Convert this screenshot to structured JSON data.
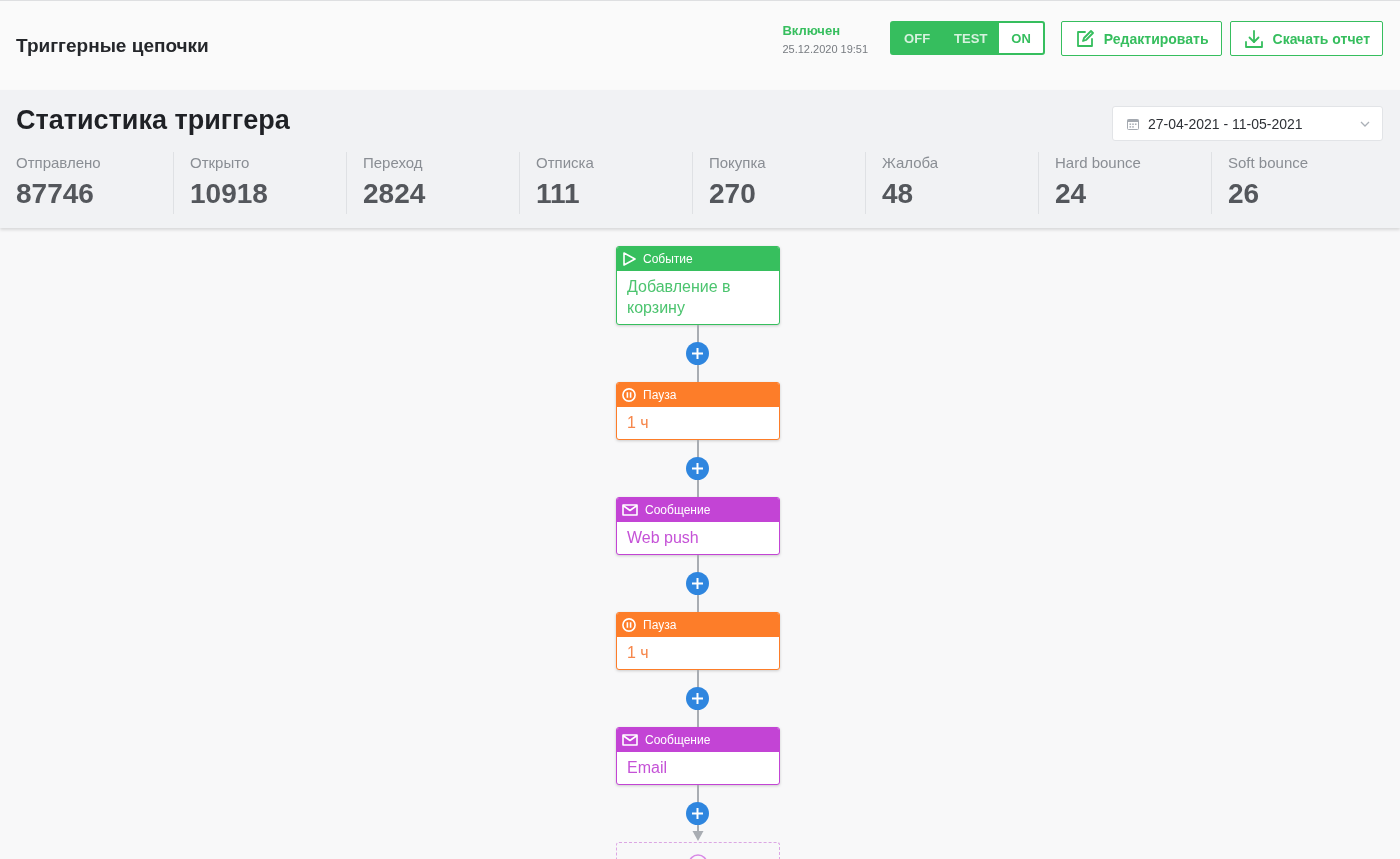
{
  "header": {
    "title": "Триггерные цепочки",
    "status": {
      "label": "Включен",
      "date": "25.12.2020 19:51"
    },
    "mode_switch": [
      {
        "label": "OFF",
        "selected": false
      },
      {
        "label": "TEST",
        "selected": false
      },
      {
        "label": "ON",
        "selected": true
      }
    ],
    "buttons": [
      {
        "kind": "edit",
        "label": "Редактировать"
      },
      {
        "kind": "download",
        "label": "Скачать отчет"
      }
    ]
  },
  "stats": {
    "title": "Статистика триггера",
    "date_range": "27-04-2021 - 11-05-2021",
    "metrics": [
      {
        "label": "Отправлено",
        "value": "87746"
      },
      {
        "label": "Открыто",
        "value": "10918"
      },
      {
        "label": "Переход",
        "value": "2824"
      },
      {
        "label": "Отписка",
        "value": "111"
      },
      {
        "label": "Покупка",
        "value": "270"
      },
      {
        "label": "Жалоба",
        "value": "48"
      },
      {
        "label": "Hard bounce",
        "value": "24"
      },
      {
        "label": "Soft bounce",
        "value": "26"
      }
    ]
  },
  "flow": {
    "nodes": [
      {
        "kind": "event",
        "type_label": "Событие",
        "text": "Добавление в корзину"
      },
      {
        "kind": "pause",
        "type_label": "Пауза",
        "text": "1 ч"
      },
      {
        "kind": "message",
        "type_label": "Сообщение",
        "text": "Web push"
      },
      {
        "kind": "pause",
        "type_label": "Пауза",
        "text": "1 ч"
      },
      {
        "kind": "message",
        "type_label": "Сообщение",
        "text": "Email"
      },
      {
        "kind": "empty"
      }
    ]
  }
}
